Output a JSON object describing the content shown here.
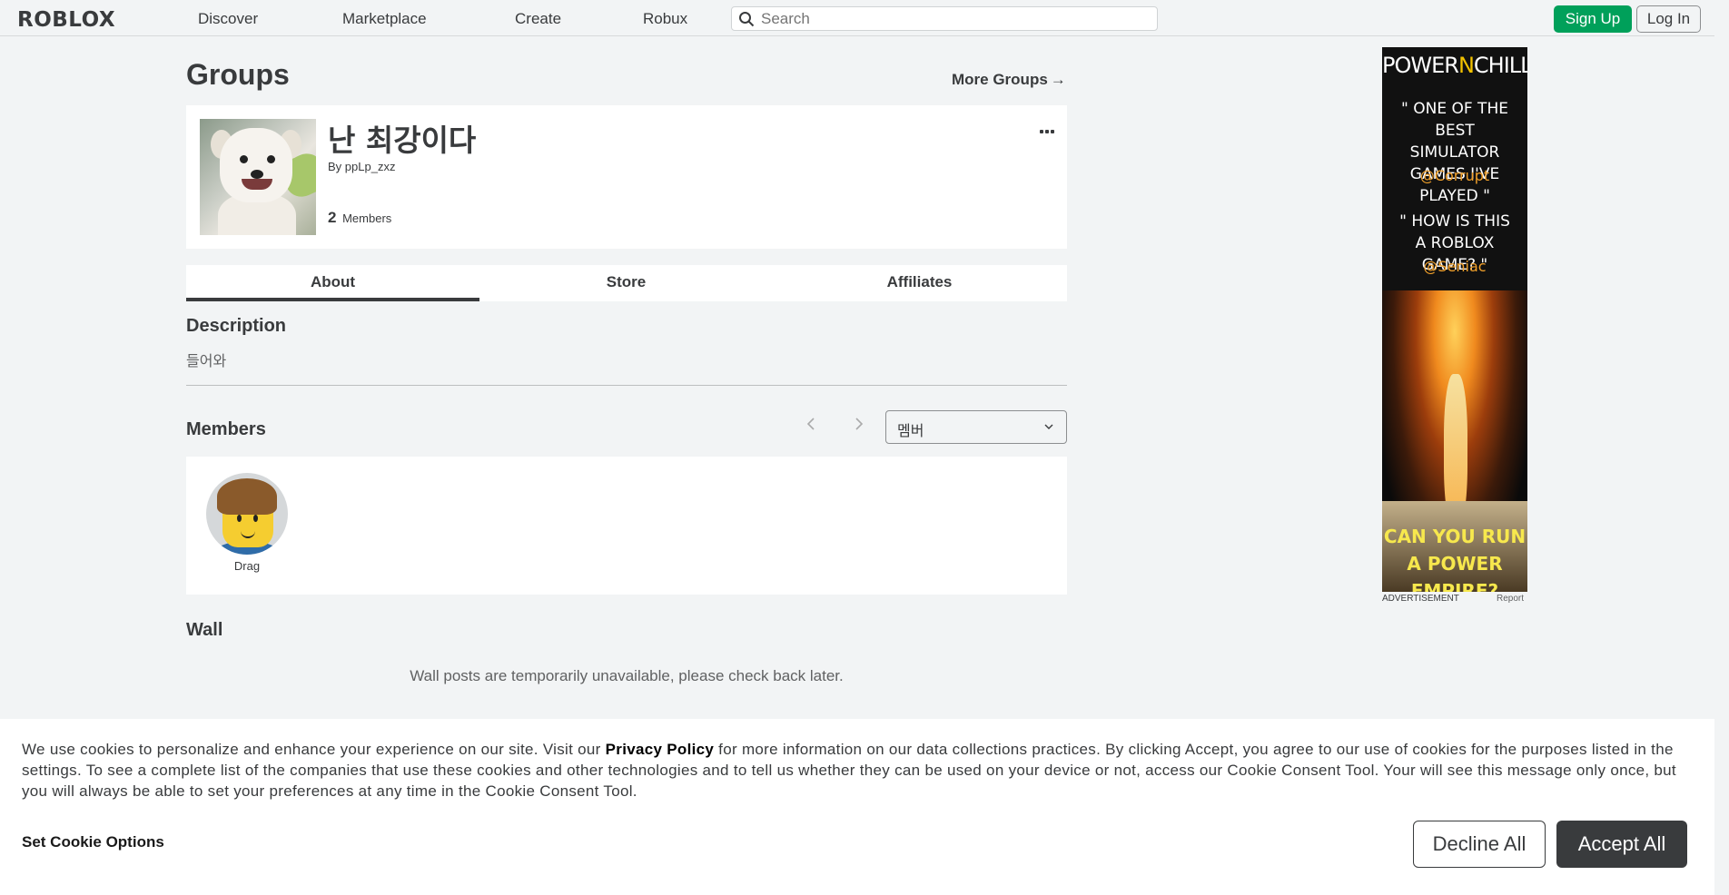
{
  "nav": {
    "logo": "ROBLOX",
    "links": [
      "Discover",
      "Marketplace",
      "Create",
      "Robux"
    ],
    "search_placeholder": "Search",
    "signup_label": "Sign Up",
    "login_label": "Log In"
  },
  "page": {
    "title": "Groups",
    "more_groups": "More Groups",
    "more_groups_arrow": "→"
  },
  "group": {
    "name": "난 최강이다",
    "by_label": "By",
    "owner": "ppLp_zxz",
    "member_count": "2",
    "members_label": "Members"
  },
  "tabs": [
    "About",
    "Store",
    "Affiliates"
  ],
  "about": {
    "description_title": "Description",
    "description_text": "들어와",
    "members_title": "Members",
    "role_selected": "멤버",
    "members": [
      {
        "name": "Drag"
      }
    ],
    "wall_title": "Wall",
    "wall_message": "Wall posts are temporarily unavailable, please check back later."
  },
  "ad": {
    "brand_pre": "POWER",
    "brand_n": "N",
    "brand_post": "CHILL",
    "quote1": "\" ONE OF THE BEST SIMULATOR GAMES I'VE PLAYED \"",
    "handle1": "@Corrupt",
    "quote2": "\" HOW IS THIS A ROBLOX GAME? \"",
    "handle2": "@Seniac",
    "cta": "CAN YOU RUN A POWER EMPIRE?",
    "label": "ADVERTISEMENT",
    "report": "Report"
  },
  "cookie": {
    "text_before": "We use cookies to personalize and enhance your experience on our site. Visit our ",
    "privacy_link": "Privacy Policy",
    "text_after": " for more information on our data collections practices. By clicking Accept, you agree to our use of cookies for the purposes listed in the settings. To see a complete list of the companies that use these cookies and other technologies and to tell us whether they can be used on your device or not, access our Cookie Consent Tool. Your will see this message only once, but you will always be able to set your preferences at any time in the Cookie Consent Tool.",
    "set_options": "Set Cookie Options",
    "decline": "Decline All",
    "accept": "Accept All"
  },
  "colors": {
    "accent_green": "#00a05a",
    "text_dark": "#393b3d",
    "background": "#f2f4f5"
  }
}
